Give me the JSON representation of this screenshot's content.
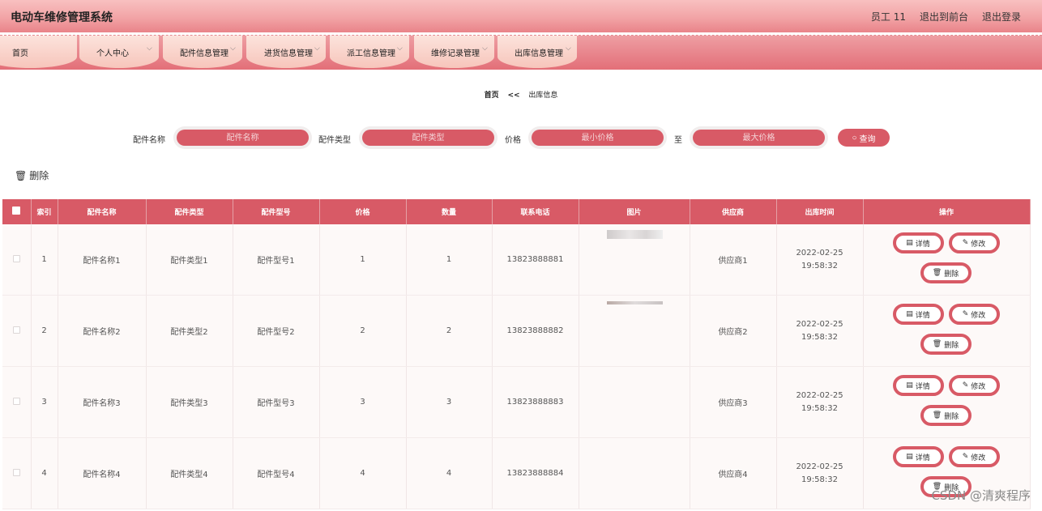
{
  "header": {
    "title": "电动车维修管理系统",
    "user": "员工 11",
    "front_link": "退出到前台",
    "logout_link": "退出登录"
  },
  "nav": [
    {
      "label": "首页",
      "has_menu": false
    },
    {
      "label": "个人中心",
      "has_menu": true
    },
    {
      "label": "配件信息管理",
      "has_menu": true
    },
    {
      "label": "进货信息管理",
      "has_menu": true
    },
    {
      "label": "派工信息管理",
      "has_menu": true
    },
    {
      "label": "维修记录管理",
      "has_menu": true
    },
    {
      "label": "出库信息管理",
      "has_menu": true
    }
  ],
  "breadcrumb": {
    "home": "首页",
    "arrow": "<<",
    "current": "出库信息"
  },
  "search": {
    "name_label": "配件名称",
    "name_placeholder": "配件名称",
    "type_label": "配件类型",
    "type_placeholder": "配件类型",
    "price_label": "价格",
    "min_placeholder": "最小价格",
    "to_label": "至",
    "max_placeholder": "最大价格",
    "query_label": "查询"
  },
  "toolbar": {
    "delete_label": "删除"
  },
  "table": {
    "columns": [
      "索引",
      "配件名称",
      "配件类型",
      "配件型号",
      "价格",
      "数量",
      "联系电话",
      "图片",
      "供应商",
      "出库时间",
      "操作"
    ],
    "rows": [
      {
        "index": "1",
        "name": "配件名称1",
        "type": "配件类型1",
        "model": "配件型号1",
        "price": "1",
        "qty": "1",
        "phone": "13823888881",
        "supplier": "供应商1",
        "time": "2022-02-25 19:58:32"
      },
      {
        "index": "2",
        "name": "配件名称2",
        "type": "配件类型2",
        "model": "配件型号2",
        "price": "2",
        "qty": "2",
        "phone": "13823888882",
        "supplier": "供应商2",
        "time": "2022-02-25 19:58:32"
      },
      {
        "index": "3",
        "name": "配件名称3",
        "type": "配件类型3",
        "model": "配件型号3",
        "price": "3",
        "qty": "3",
        "phone": "13823888883",
        "supplier": "供应商3",
        "time": "2022-02-25 19:58:32"
      },
      {
        "index": "4",
        "name": "配件名称4",
        "type": "配件类型4",
        "model": "配件型号4",
        "price": "4",
        "qty": "4",
        "phone": "13823888884",
        "supplier": "供应商4",
        "time": "2022-02-25 19:58:32"
      }
    ],
    "actions": {
      "detail": "详情",
      "edit": "修改",
      "delete": "删除"
    }
  },
  "watermark": "CSDN @清爽程序",
  "colors": {
    "primary": "#d85a66",
    "header_top": "#f8c0c0",
    "nav_tab": "#f7c5bb"
  }
}
